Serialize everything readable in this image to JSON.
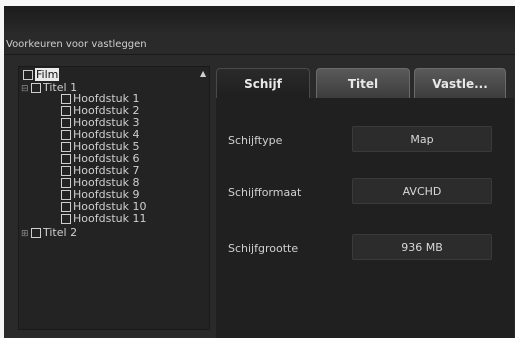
{
  "panel": {
    "title": "Voorkeuren voor vastleggen"
  },
  "tree": {
    "root": "Film",
    "title1": "Titel 1",
    "chapters": [
      "Hoofdstuk 1",
      "Hoofdstuk 2",
      "Hoofdstuk 3",
      "Hoofdstuk 4",
      "Hoofdstuk 5",
      "Hoofdstuk 6",
      "Hoofdstuk 7",
      "Hoofdstuk 8",
      "Hoofdstuk 9",
      "Hoofdstuk 10",
      "Hoofdstuk 11"
    ],
    "title2": "Titel 2"
  },
  "tabs": {
    "schijf": "Schijf",
    "titel": "Titel",
    "vastleggen": "Vastle..."
  },
  "fields": {
    "schijftype": {
      "label": "Schijftype",
      "value": "Map"
    },
    "schijfformaat": {
      "label": "Schijfformaat",
      "value": "AVCHD"
    },
    "schijfgrootte": {
      "label": "Schijfgrootte",
      "value": "936 MB"
    }
  }
}
